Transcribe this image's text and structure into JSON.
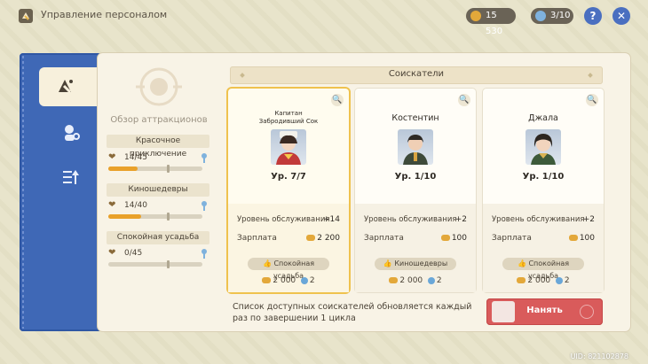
{
  "header": {
    "title": "Управление персоналом",
    "currency_value": "15 530",
    "staff_count": "3/10",
    "help_glyph": "?",
    "close_glyph": "✕"
  },
  "sidebar": {
    "tabs": [
      {
        "icon": "staff-management-icon",
        "active": true
      },
      {
        "icon": "staff-profiles-icon",
        "active": false
      },
      {
        "icon": "promotion-list-icon",
        "active": false
      }
    ]
  },
  "summary": {
    "title": "Обзор аттракционов",
    "attractions": [
      {
        "name": "Красочное приключение",
        "count": "14/45",
        "progress": 0.31
      },
      {
        "name": "Киношедевры",
        "count": "14/40",
        "progress": 0.35
      },
      {
        "name": "Спокойная усадьба",
        "count": "0/45",
        "progress": 0.0
      }
    ]
  },
  "applicants": {
    "header": "Соискатели",
    "zoom_glyph": "🔍",
    "service_label": "Уровень обслуживания",
    "salary_label": "Зарплата",
    "items": [
      {
        "name_line1": "Капитан",
        "name_line2": "Забродивший Сок",
        "level": "Ур. 7/7",
        "service": "+14",
        "salary": "2 200",
        "tag": "Спокойная усадьба",
        "cost_coins": "2 000",
        "cost_gems": "2",
        "selected": true
      },
      {
        "name_line1": "Костентин",
        "name_line2": "",
        "level": "Ур. 1/10",
        "service": "+2",
        "salary": "100",
        "tag": "Киношедевры",
        "cost_coins": "2 000",
        "cost_gems": "2",
        "selected": false
      },
      {
        "name_line1": "Джала",
        "name_line2": "",
        "level": "Ур. 1/10",
        "service": "+2",
        "salary": "100",
        "tag": "Спокойная усадьба",
        "cost_coins": "2 000",
        "cost_gems": "2",
        "selected": false
      }
    ]
  },
  "footer": {
    "note": "Список доступных соискателей обновляется каждый раз по завершении 1 цикла",
    "hire_label": "Нанять",
    "uid": "UID: 821102878"
  },
  "colors": {
    "accent_blue": "#3f68b6",
    "hire_red": "#d95b5b",
    "selected_gold": "#efc24e",
    "progress_orange": "#e9a12a"
  }
}
